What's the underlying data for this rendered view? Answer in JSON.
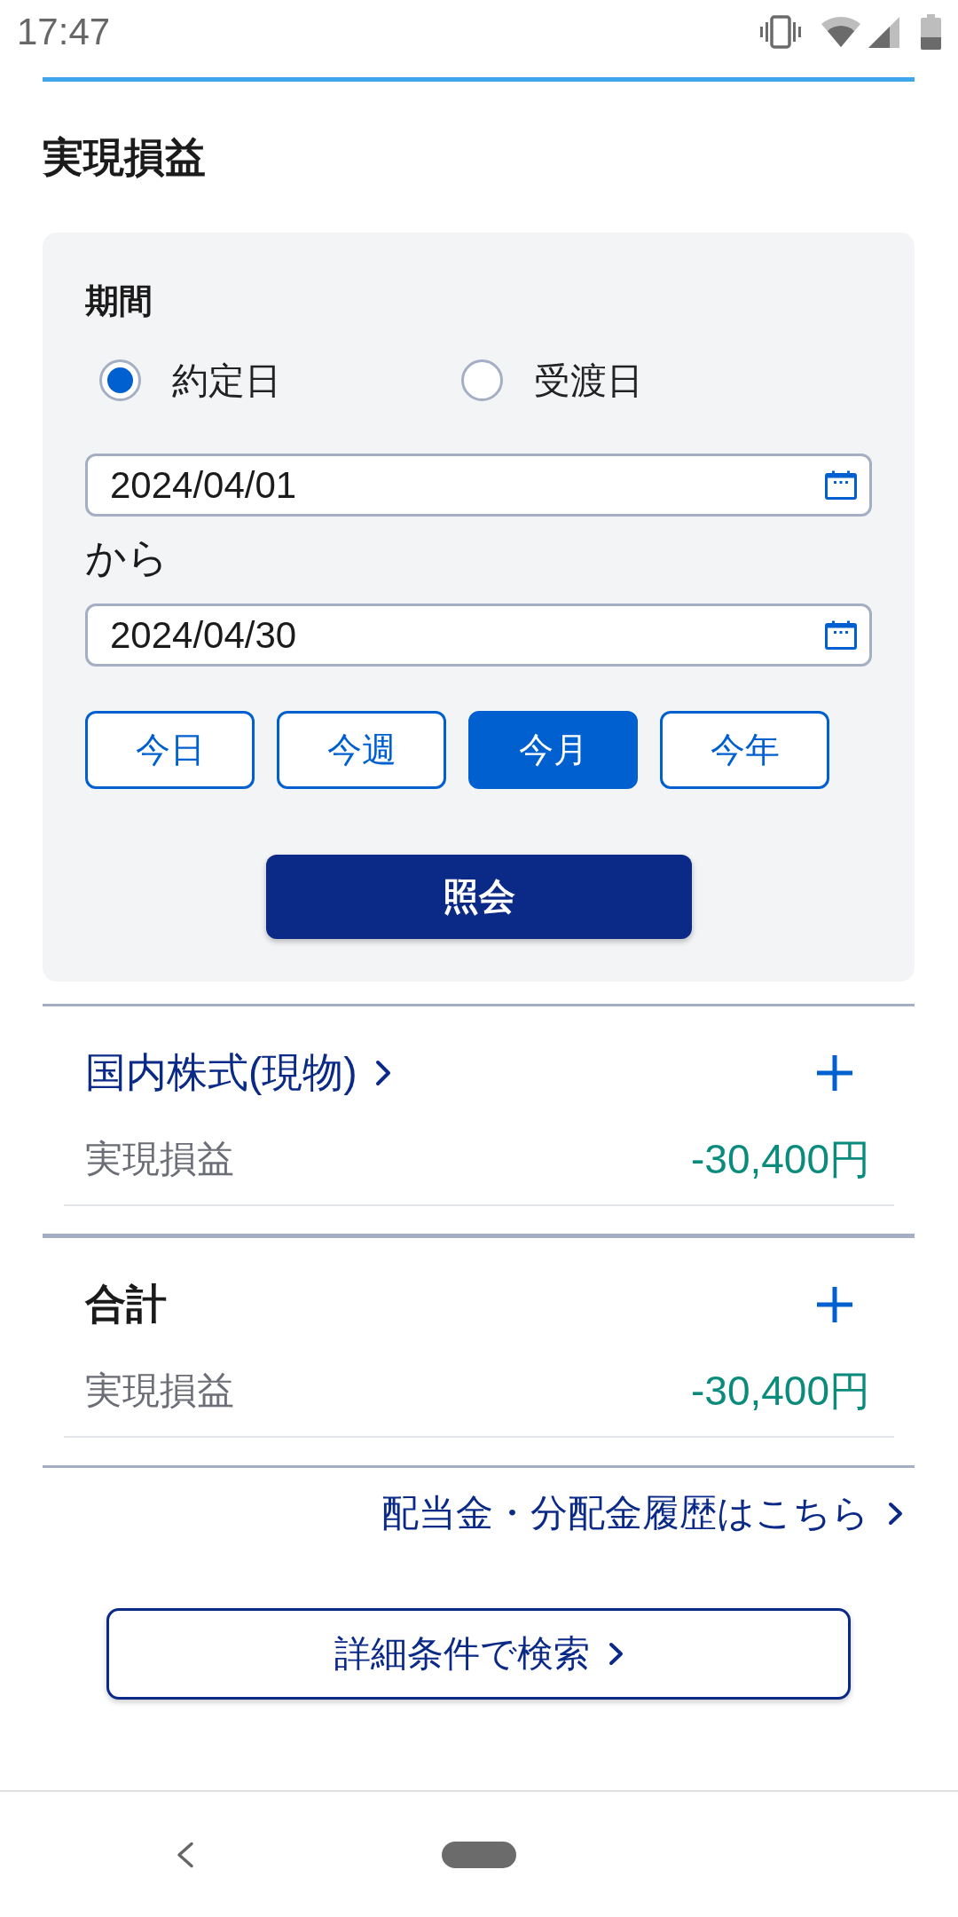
{
  "status_bar": {
    "time": "17:47"
  },
  "page_title": "実現損益",
  "search_form": {
    "period_label": "期間",
    "date_basis": [
      {
        "label": "約定日",
        "selected": true
      },
      {
        "label": "受渡日",
        "selected": false
      }
    ],
    "start_date": {
      "value": "2024/04/01"
    },
    "range_separator": "から",
    "end_date": {
      "value": "2024/04/30"
    },
    "quick_ranges": [
      {
        "label": "今日",
        "selected": false
      },
      {
        "label": "今週",
        "selected": false
      },
      {
        "label": "今月",
        "selected": true
      },
      {
        "label": "今年",
        "selected": false
      }
    ],
    "submit_button": "照会"
  },
  "sections": [
    {
      "kind": "category",
      "title": "国内株式(現物)",
      "expanded": false,
      "rows": [
        {
          "label": "実現損益",
          "value": "-30,400円"
        }
      ]
    },
    {
      "kind": "total",
      "title": "合計",
      "expanded": false,
      "rows": [
        {
          "label": "実現損益",
          "value": "-30,400円"
        }
      ]
    }
  ],
  "history_link": "配当金・分配金履歴はこちら",
  "detail_search_button": "詳細条件で検索"
}
